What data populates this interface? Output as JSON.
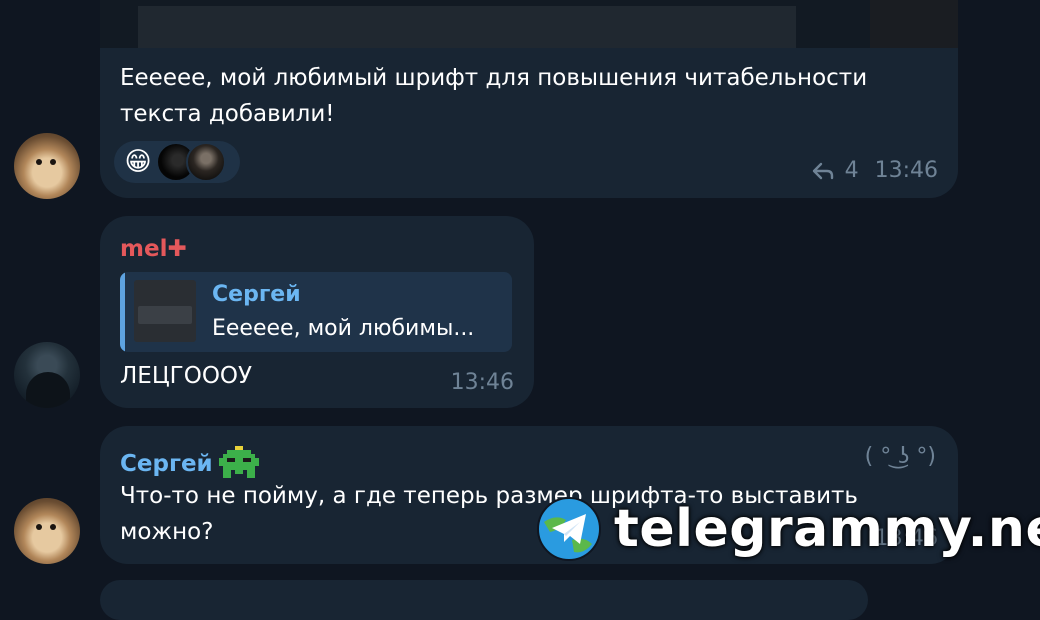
{
  "messages": [
    {
      "text": "Ееееее, мой любимый шрифт для повышения читабельности текста добавили!",
      "replies": "4",
      "time": "13:46",
      "reactions": [
        "😁"
      ]
    },
    {
      "sender": "mel",
      "reply": {
        "author": "Сергей",
        "preview": "Ееееее, мой любимы..."
      },
      "text": "ЛЕЦГОООУ",
      "time": "13:46"
    },
    {
      "sender": "Сергей",
      "kaomoji": "( ° ͜ʖ °)",
      "text": "Что-то не пойму, а где теперь размер шрифта-то выставить можно?",
      "time": "13:46"
    }
  ],
  "watermark": {
    "text": "telegrammy.net"
  },
  "colors": {
    "background": "#0f1621",
    "bubble": "#182533",
    "sender_mel": "#e4585b",
    "sender_sergey": "#6bb6f2",
    "meta": "#6f8396"
  }
}
